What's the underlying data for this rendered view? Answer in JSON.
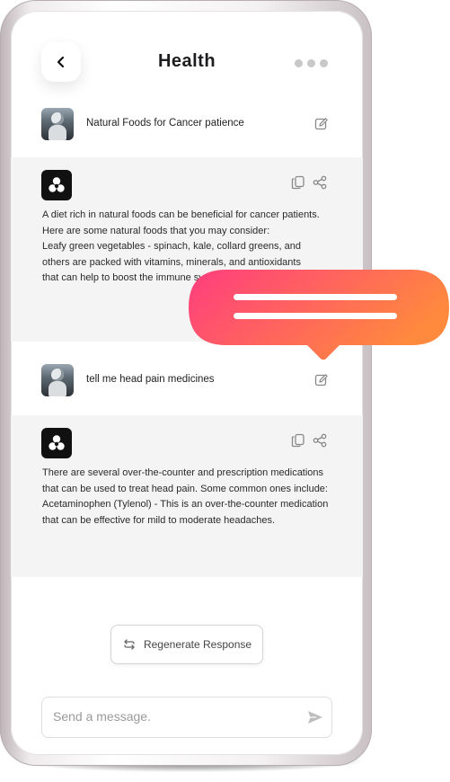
{
  "header": {
    "title": "Health",
    "back_icon": "chevron-left-icon",
    "more_icon": "more-dots-icon"
  },
  "conversation": [
    {
      "user": {
        "text": "Natural Foods for Cancer patience",
        "avatar": "robot-avatar",
        "edit_icon": "edit-icon"
      },
      "bot": {
        "logo": "ai-logo-icon",
        "lines": [
          "A diet rich in natural foods can be beneficial for cancer patients.",
          "Here are some natural foods that you may consider:",
          "Leafy green vegetables - spinach, kale, collard greens, and",
          "others are packed with vitamins, minerals, and antioxidants",
          "that can help to boost the immune system."
        ]
      }
    },
    {
      "user": {
        "text": "tell me head pain medicines",
        "avatar": "robot-avatar",
        "edit_icon": "edit-icon"
      },
      "bot": {
        "logo": "ai-logo-icon",
        "lines": [
          "There are several over-the-counter and prescription medications",
          "that can be used to treat head pain. Some common ones include:",
          "Acetaminophen (Tylenol) - This is an over-the-counter medication",
          "that can be effective for mild to moderate headaches."
        ]
      }
    }
  ],
  "regenerate": {
    "label": "Regenerate Response",
    "icon": "regenerate-icon"
  },
  "composer": {
    "placeholder": "Send a message.",
    "send_icon": "send-icon"
  },
  "colors": {
    "bubble_gradient_start": "#ff3d7f",
    "bubble_gradient_end": "#ff8a3d",
    "bot_background": "#f4f4f4"
  }
}
